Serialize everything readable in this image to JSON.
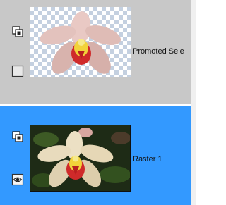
{
  "layers": [
    {
      "name": "Promoted Selection",
      "display_name": "Promoted Sele",
      "selected": false,
      "visible": false,
      "icons": [
        "layer-group-icon",
        "visibility-off-icon"
      ],
      "thumbnail": "orchid-transparent-thumbnail"
    },
    {
      "name": "Raster 1",
      "selected": true,
      "visible": true,
      "icons": [
        "layer-group-icon",
        "eye-icon"
      ],
      "thumbnail": "orchid-dark-background-thumbnail"
    }
  ],
  "colors": {
    "unselected_row": "#c8c8c8",
    "selected_row": "#3399ff",
    "checker": "#c4d0e0"
  }
}
